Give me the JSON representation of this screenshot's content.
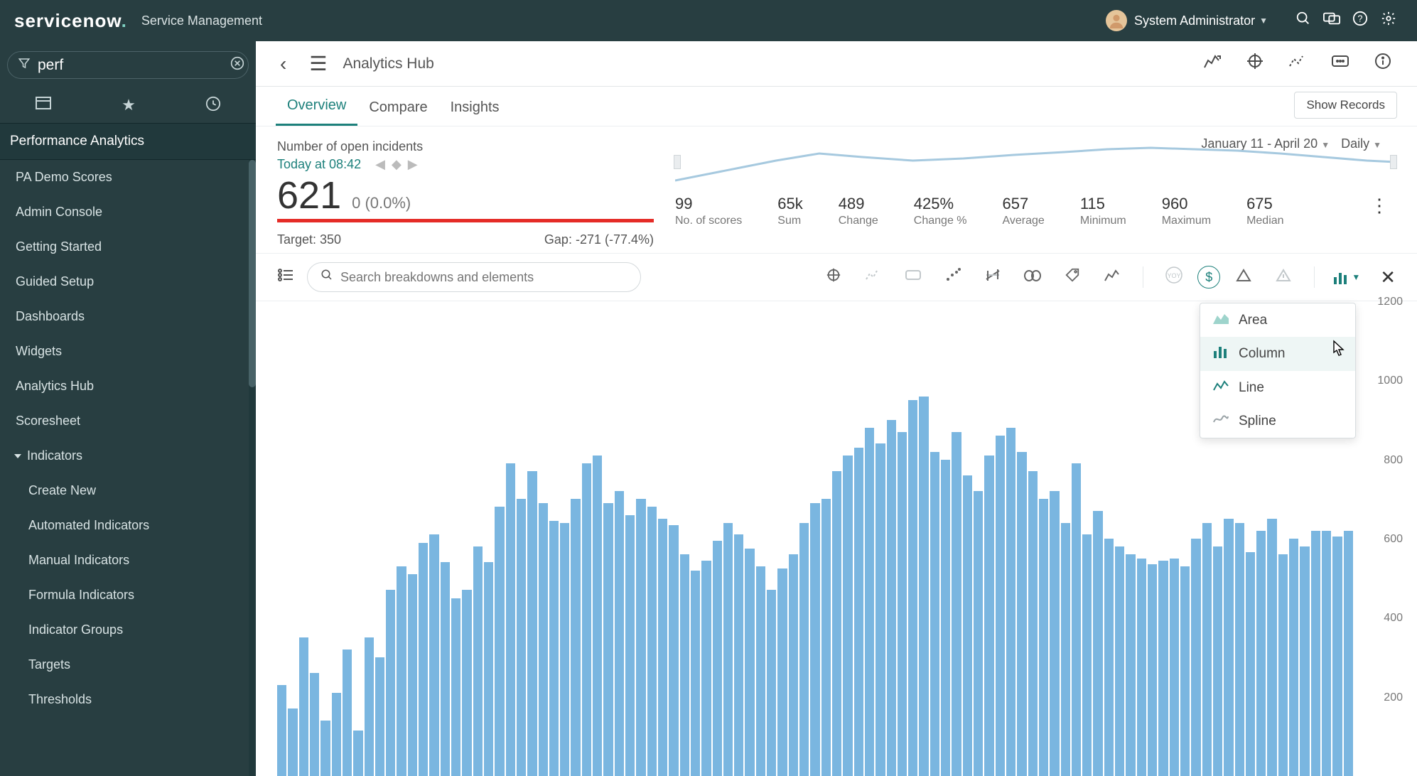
{
  "brand": {
    "name": "servicenow",
    "sub": "Service Management"
  },
  "user": {
    "name": "System Administrator"
  },
  "nav": {
    "filter_value": "perf",
    "section": "Performance Analytics",
    "items": [
      "PA Demo Scores",
      "Admin Console",
      "Getting Started",
      "Guided Setup",
      "Dashboards",
      "Widgets",
      "Analytics Hub",
      "Scoresheet"
    ],
    "ind_label": "Indicators",
    "ind_children": [
      "Create New",
      "Automated Indicators",
      "Manual Indicators",
      "Formula Indicators",
      "Indicator Groups",
      "Targets",
      "Thresholds"
    ]
  },
  "hub": {
    "title": "Analytics Hub"
  },
  "tabs": {
    "items": [
      "Overview",
      "Compare",
      "Insights"
    ],
    "show_records": "Show Records"
  },
  "kpi": {
    "title": "Number of open incidents",
    "time": "Today at 08:42",
    "value": "621",
    "delta": "0 (0.0%)",
    "target_label": "Target: 350",
    "gap_label": "Gap: -271 (-77.4%)"
  },
  "range": {
    "label": "January 11 - April 20",
    "grain": "Daily"
  },
  "stats": [
    {
      "v": "99",
      "l": "No. of scores"
    },
    {
      "v": "65k",
      "l": "Sum"
    },
    {
      "v": "489",
      "l": "Change"
    },
    {
      "v": "425%",
      "l": "Change %"
    },
    {
      "v": "657",
      "l": "Average"
    },
    {
      "v": "115",
      "l": "Minimum"
    },
    {
      "v": "960",
      "l": "Maximum"
    },
    {
      "v": "675",
      "l": "Median"
    }
  ],
  "ctool": {
    "placeholder": "Search breakdowns and elements"
  },
  "chart_type_menu": [
    "Area",
    "Column",
    "Line",
    "Spline"
  ],
  "chart_data": {
    "type": "bar",
    "title": "Number of open incidents",
    "xlabel": "",
    "ylabel": "",
    "ylim": [
      0,
      1200
    ],
    "yticks": [
      200,
      400,
      600,
      800,
      1000,
      1200
    ],
    "categories_note": "Daily, Jan 11 – Apr 20 (≈99 days, categories implied by position)",
    "values": [
      230,
      170,
      350,
      260,
      140,
      210,
      320,
      115,
      350,
      300,
      470,
      530,
      510,
      590,
      610,
      540,
      450,
      470,
      580,
      540,
      680,
      790,
      700,
      770,
      690,
      645,
      640,
      700,
      790,
      810,
      690,
      720,
      660,
      700,
      680,
      650,
      635,
      560,
      520,
      545,
      595,
      640,
      610,
      575,
      530,
      470,
      525,
      560,
      640,
      690,
      700,
      770,
      810,
      830,
      880,
      840,
      900,
      870,
      950,
      960,
      820,
      800,
      870,
      760,
      720,
      810,
      860,
      880,
      820,
      770,
      700,
      720,
      640,
      790,
      610,
      670,
      600,
      580,
      560,
      550,
      535,
      545,
      550,
      530,
      600,
      640,
      580,
      650,
      640,
      565,
      620,
      650,
      560,
      600,
      580,
      620,
      620,
      605,
      620
    ]
  }
}
